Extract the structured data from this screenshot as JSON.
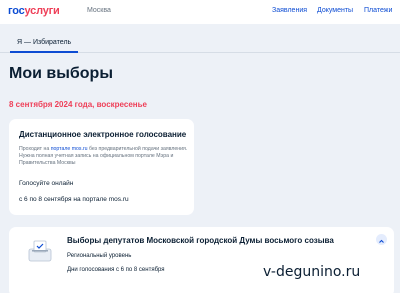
{
  "header": {
    "logo_gos": "гос",
    "logo_uslugi": "услуги",
    "city": "Москва",
    "nav": [
      "Заявления",
      "Документы",
      "Платежи"
    ]
  },
  "tabs": [
    {
      "label": "Я — Избиратель",
      "active": true
    }
  ],
  "page": {
    "title": "Мои выборы",
    "date": "8 сентября 2024 года, воскресенье"
  },
  "remote_voting": {
    "title": "Дистанционное электронное голосование",
    "desc_before": "Проходит на ",
    "desc_link": "портале mos.ru",
    "desc_after": " без предварительной подачи заявления. Нужна полная учетная запись на официальном портале Мэра и Правительства Москвы",
    "vote_text": "Голосуйте онлайн",
    "period_text": "с 6 по 8 сентября на портале mos.ru"
  },
  "election": {
    "title": "Выборы депутатов Московской городской Думы восьмого созыва",
    "level": "Региональный уровень",
    "days": "Дни голосования с 6 по 8 сентября",
    "icon": "ballot-box-icon",
    "expanded": true
  },
  "watermark": "v-degunino.ru",
  "colors": {
    "accent": "#0d4cd3",
    "red": "#ee3f58",
    "background": "#edf1f7",
    "text": "#0b1f33",
    "muted": "#66727f"
  }
}
